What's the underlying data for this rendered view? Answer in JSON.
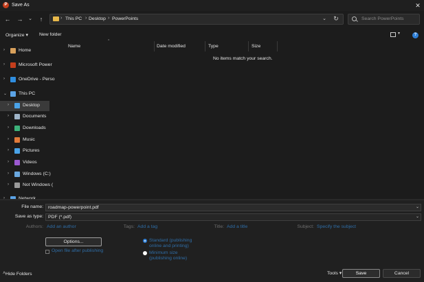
{
  "window": {
    "title": "Save As",
    "app_icon_letter": "P",
    "app_icon_color": "#c43e1c"
  },
  "nav": {
    "back_icon": "arrow-left-icon",
    "forward_icon": "arrow-right-icon",
    "recent_icon": "chevron-down-icon",
    "up_icon": "arrow-up-icon"
  },
  "address": {
    "crumbs": [
      "This PC",
      "Desktop",
      "PowerPoints"
    ]
  },
  "search": {
    "placeholder": "Search PowerPoints"
  },
  "toolbar": {
    "organize": "Organize ▾",
    "new_folder": "New folder",
    "help": "?"
  },
  "sidebar": {
    "items": [
      {
        "label": "Home",
        "icon": "home-icon",
        "color": "#d9a05b"
      },
      {
        "label": "Microsoft Power",
        "icon": "powerpoint-icon",
        "color": "#c43e1c"
      },
      {
        "label": "OneDrive - Perso",
        "icon": "cloud-icon",
        "color": "#2f8ee0"
      },
      {
        "label": "This PC",
        "icon": "computer-icon",
        "color": "#5ba3e6"
      },
      {
        "label": "Desktop",
        "icon": "desktop-icon",
        "color": "#4aa3e8"
      },
      {
        "label": "Documents",
        "icon": "documents-icon",
        "color": "#9fb4c8"
      },
      {
        "label": "Downloads",
        "icon": "download-icon",
        "color": "#3db27a"
      },
      {
        "label": "Music",
        "icon": "music-icon",
        "color": "#e07a3a"
      },
      {
        "label": "Pictures",
        "icon": "pictures-icon",
        "color": "#4aa3e8"
      },
      {
        "label": "Videos",
        "icon": "videos-icon",
        "color": "#9b59d0"
      },
      {
        "label": "Windows (C:)",
        "icon": "drive-icon",
        "color": "#6aa8e0"
      },
      {
        "label": "Not Windows (",
        "icon": "drive-icon",
        "color": "#9a9a9a"
      },
      {
        "label": "Network",
        "icon": "network-icon",
        "color": "#5ba3e6"
      }
    ]
  },
  "list": {
    "columns": [
      "Name",
      "Date modified",
      "Type",
      "Size"
    ],
    "sort_arrow": "^",
    "empty_message": "No items match your search."
  },
  "form": {
    "file_name_label": "File name:",
    "file_name_value": "roadmap-powerpoint.pdf",
    "save_type_label": "Save as type:",
    "save_type_value": "PDF (*.pdf)",
    "authors_label": "Authors:",
    "authors_value": "Add an author",
    "tags_label": "Tags:",
    "tags_value": "Add a tag",
    "title_label": "Title:",
    "title_value": "Add a title",
    "subject_label": "Subject:",
    "subject_value": "Specify the subject",
    "options_button": "Options...",
    "open_after_label": "Open file after publishing",
    "radio_standard": "Standard (publishing online and printing)",
    "radio_minimum": "Minimum size (publishing online)"
  },
  "footer": {
    "hide_folders": "Hide Folders",
    "tools": "Tools",
    "save": "Save",
    "cancel": "Cancel"
  },
  "colors": {
    "accent": "#2f7fd6",
    "link": "#2f6ea8"
  }
}
